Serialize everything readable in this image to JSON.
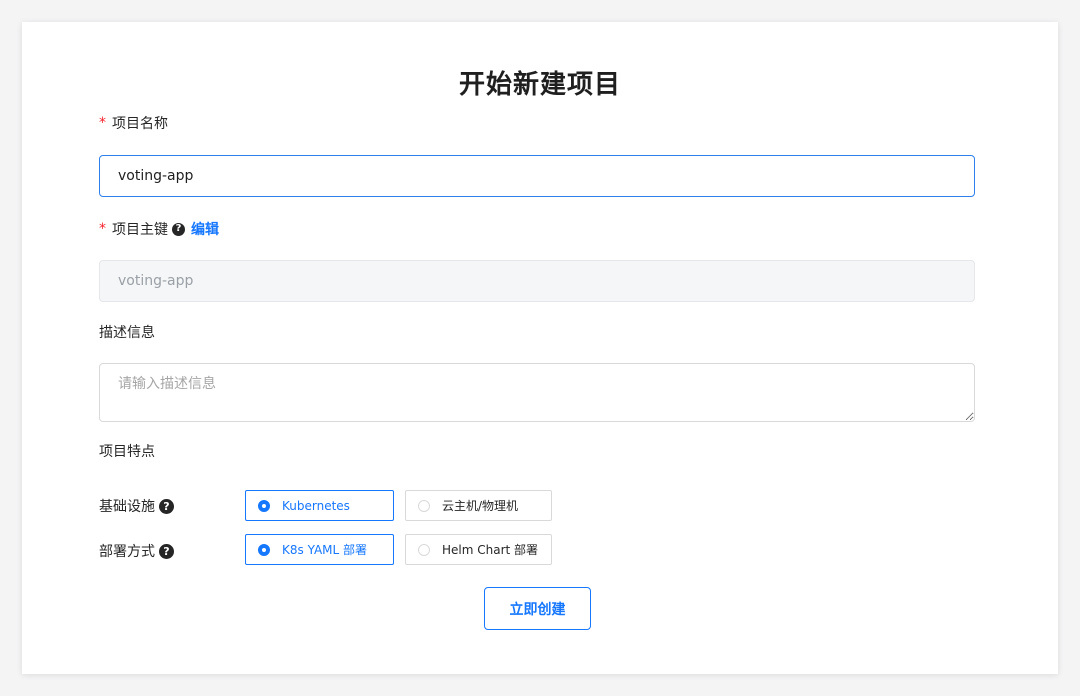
{
  "page": {
    "title": "开始新建项目"
  },
  "form": {
    "project_name": {
      "required_mark": "*",
      "label": "项目名称",
      "value": "voting-app"
    },
    "project_key": {
      "required_mark": "*",
      "label": "项目主键",
      "help_icon": "question-circle",
      "edit_label": "编辑",
      "value": "voting-app"
    },
    "description": {
      "label": "描述信息",
      "placeholder": "请输入描述信息",
      "value": ""
    },
    "features": {
      "label": "项目特点"
    },
    "infrastructure": {
      "label": "基础设施",
      "help_icon": "question-circle",
      "options": [
        "Kubernetes",
        "云主机/物理机"
      ],
      "selected": "Kubernetes"
    },
    "deploy_method": {
      "label": "部署方式",
      "help_icon": "question-circle",
      "options": [
        "K8s YAML 部署",
        "Helm Chart 部署"
      ],
      "selected": "K8s YAML 部署"
    },
    "submit_label": "立即创建"
  },
  "colors": {
    "primary": "#1677ff",
    "required": "#f5222d",
    "focus_border": "#2f80ed"
  }
}
